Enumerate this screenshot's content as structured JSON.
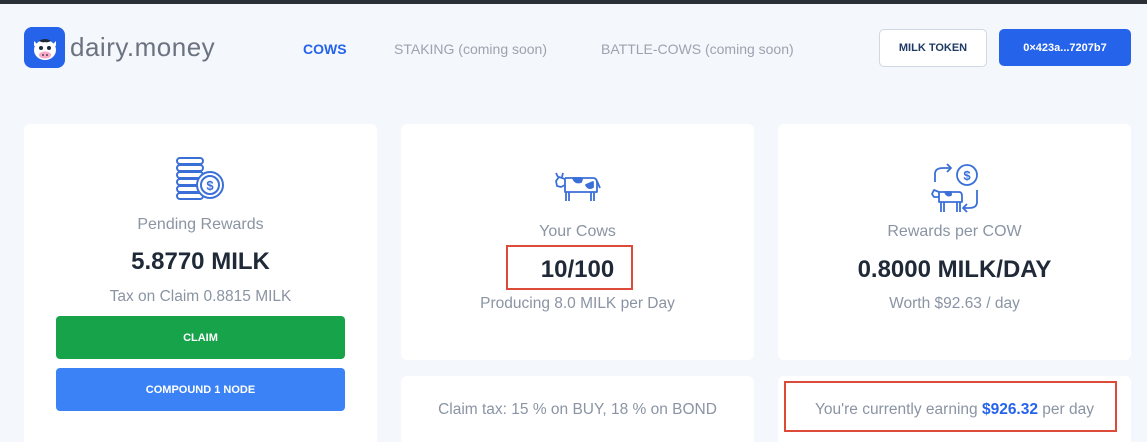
{
  "header": {
    "logo_text": "dairy.money",
    "logo_icon": "cow-face-icon",
    "nav": [
      {
        "label": "COWS"
      },
      {
        "label": "STAKING (coming soon)"
      },
      {
        "label": "BATTLE-COWS (coming soon)"
      }
    ],
    "token_button": "MILK TOKEN",
    "wallet_button": "0×423a...7207b7"
  },
  "cards": {
    "pending": {
      "icon": "coins-icon",
      "label": "Pending Rewards",
      "value": "5.8770 MILK",
      "sub": "Tax on Claim 0.8815 MILK",
      "claim_label": "CLAIM",
      "compound_label": "COMPOUND 1 NODE"
    },
    "cows": {
      "icon": "cow-icon",
      "label": "Your Cows",
      "value": "10/100",
      "sub": "Producing 8.0 MILK per Day"
    },
    "rewards": {
      "icon": "cow-exchange-icon",
      "label": "Rewards per COW",
      "value": "0.8000 MILK/DAY",
      "sub": "Worth $92.63 / day"
    },
    "tax": {
      "text": "Claim tax: 15 % on BUY, 18 % on BOND"
    },
    "earning": {
      "prefix": "You're currently earning",
      "amount": "$926.32",
      "suffix": "per day"
    }
  },
  "colors": {
    "accent": "#2563eb",
    "claim": "#16a34a",
    "compound": "#3b82f6",
    "highlight": "#dc4a3a",
    "background": "#f4f7fb"
  }
}
